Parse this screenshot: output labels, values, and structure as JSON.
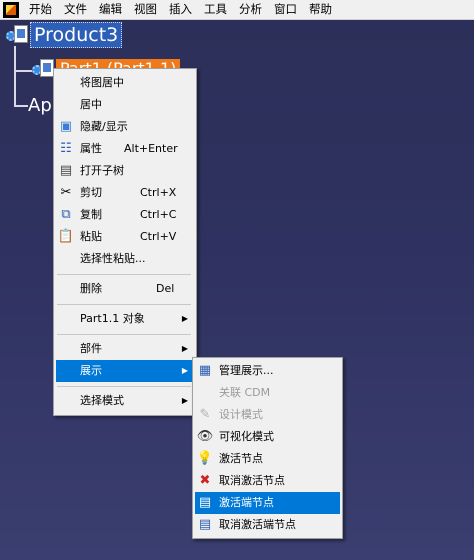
{
  "menubar": {
    "items": [
      "开始",
      "文件",
      "编辑",
      "视图",
      "插入",
      "工具",
      "分析",
      "窗口",
      "帮助"
    ]
  },
  "tree": {
    "root": "Product3",
    "part": "Part1 (Part1.1)",
    "ap": "Ap"
  },
  "context_menu": {
    "items": [
      {
        "label": "将图居中"
      },
      {
        "label": "居中"
      },
      {
        "label": "隐藏/显示"
      },
      {
        "label": "属性",
        "shortcut": "Alt+Enter"
      },
      {
        "label": "打开子树"
      },
      {
        "label": "剪切",
        "shortcut": "Ctrl+X"
      },
      {
        "label": "复制",
        "shortcut": "Ctrl+C"
      },
      {
        "label": "粘贴",
        "shortcut": "Ctrl+V"
      },
      {
        "label": "选择性粘贴..."
      },
      {
        "label": "删除",
        "shortcut": "Del"
      },
      {
        "label": "Part1.1 对象"
      },
      {
        "label": "部件"
      },
      {
        "label": "展示"
      },
      {
        "label": "选择模式"
      }
    ]
  },
  "submenu": {
    "items": [
      {
        "label": "管理展示..."
      },
      {
        "label": "关联 CDM"
      },
      {
        "label": "设计模式"
      },
      {
        "label": "可视化模式"
      },
      {
        "label": "激活节点"
      },
      {
        "label": "取消激活节点"
      },
      {
        "label": "激活端节点"
      },
      {
        "label": "取消激活端节点"
      }
    ]
  },
  "colors": {
    "highlight": "#0078d7",
    "selected_node": "#f07a1a",
    "background": "#2f3260"
  }
}
